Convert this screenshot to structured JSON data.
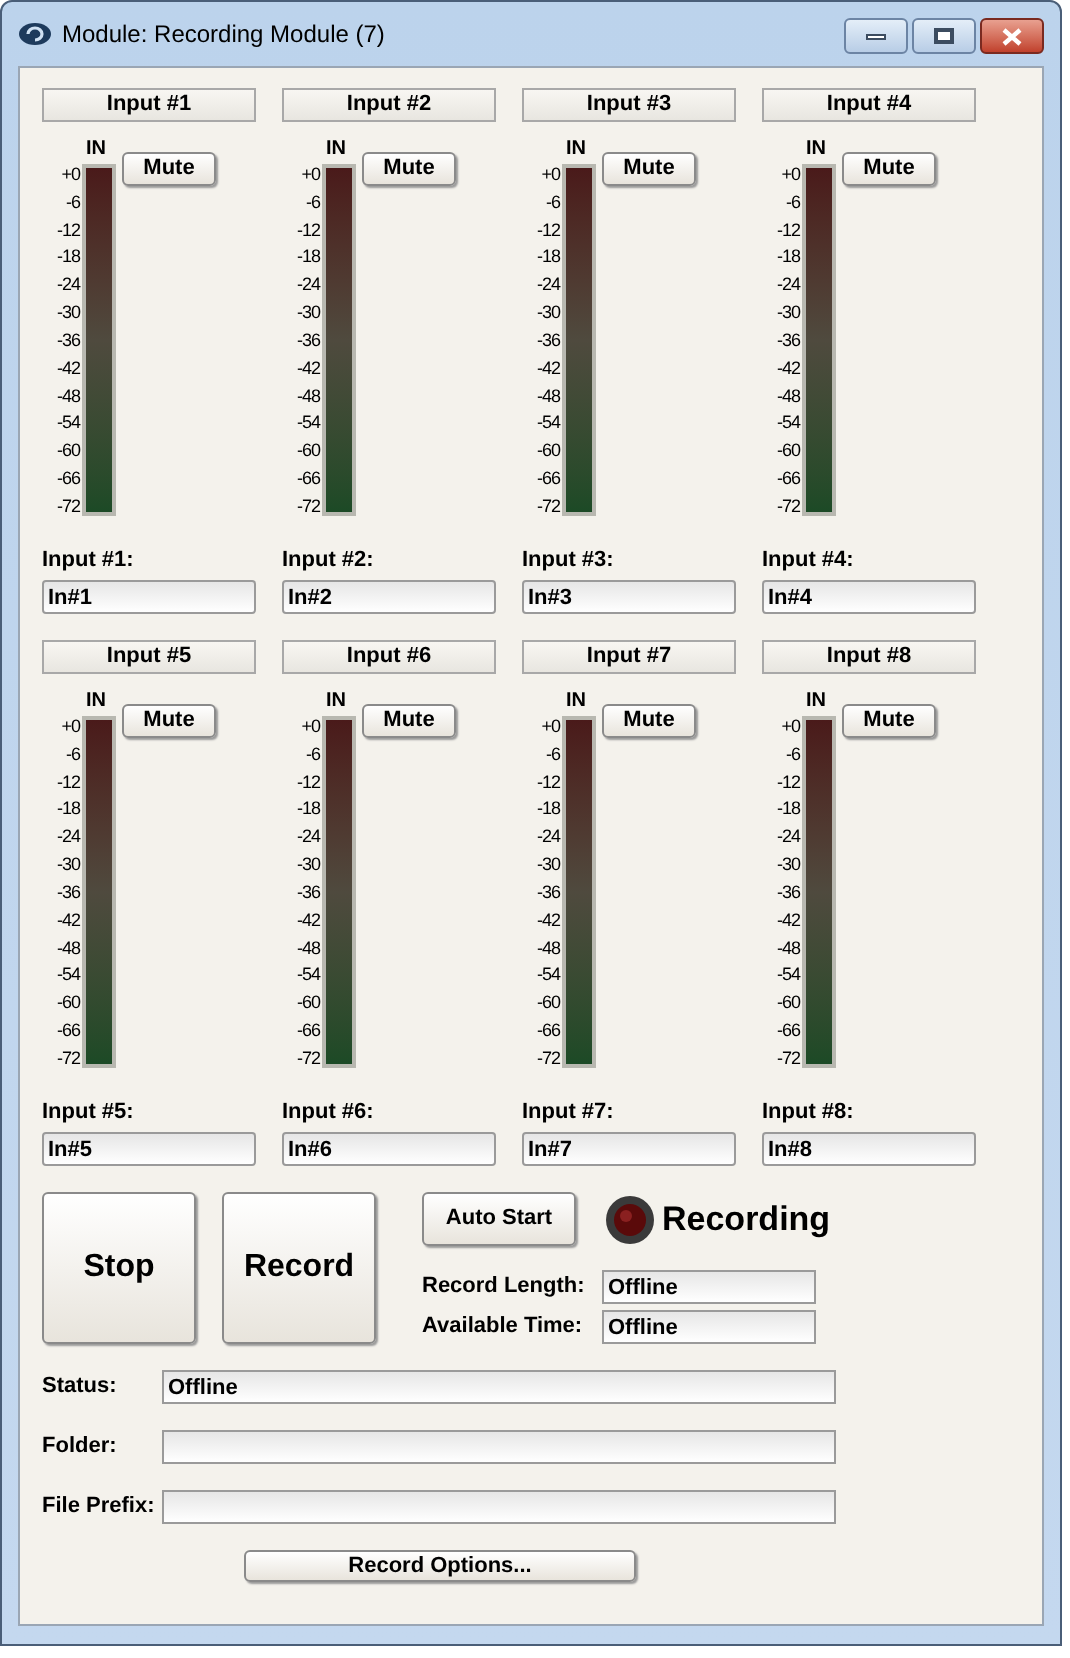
{
  "window": {
    "title": "Module: Recording Module (7)"
  },
  "channels": [
    {
      "header": "Input #1",
      "meter_label": "IN",
      "scale": [
        "+0",
        "-6",
        "-12",
        "-18",
        "-24",
        "-30",
        "-36",
        "-42",
        "-48",
        "-54",
        "-60",
        "-66",
        "-72"
      ],
      "mute": "Mute",
      "field_label": "Input #1:",
      "value": "In#1"
    },
    {
      "header": "Input #2",
      "meter_label": "IN",
      "scale": [
        "+0",
        "-6",
        "-12",
        "-18",
        "-24",
        "-30",
        "-36",
        "-42",
        "-48",
        "-54",
        "-60",
        "-66",
        "-72"
      ],
      "mute": "Mute",
      "field_label": "Input #2:",
      "value": "In#2"
    },
    {
      "header": "Input #3",
      "meter_label": "IN",
      "scale": [
        "+0",
        "-6",
        "-12",
        "-18",
        "-24",
        "-30",
        "-36",
        "-42",
        "-48",
        "-54",
        "-60",
        "-66",
        "-72"
      ],
      "mute": "Mute",
      "field_label": "Input #3:",
      "value": "In#3"
    },
    {
      "header": "Input #4",
      "meter_label": "IN",
      "scale": [
        "+0",
        "-6",
        "-12",
        "-18",
        "-24",
        "-30",
        "-36",
        "-42",
        "-48",
        "-54",
        "-60",
        "-66",
        "-72"
      ],
      "mute": "Mute",
      "field_label": "Input #4:",
      "value": "In#4"
    },
    {
      "header": "Input #5",
      "meter_label": "IN",
      "scale": [
        "+0",
        "-6",
        "-12",
        "-18",
        "-24",
        "-30",
        "-36",
        "-42",
        "-48",
        "-54",
        "-60",
        "-66",
        "-72"
      ],
      "mute": "Mute",
      "field_label": "Input #5:",
      "value": "In#5"
    },
    {
      "header": "Input #6",
      "meter_label": "IN",
      "scale": [
        "+0",
        "-6",
        "-12",
        "-18",
        "-24",
        "-30",
        "-36",
        "-42",
        "-48",
        "-54",
        "-60",
        "-66",
        "-72"
      ],
      "mute": "Mute",
      "field_label": "Input #6:",
      "value": "In#6"
    },
    {
      "header": "Input #7",
      "meter_label": "IN",
      "scale": [
        "+0",
        "-6",
        "-12",
        "-18",
        "-24",
        "-30",
        "-36",
        "-42",
        "-48",
        "-54",
        "-60",
        "-66",
        "-72"
      ],
      "mute": "Mute",
      "field_label": "Input #7:",
      "value": "In#7"
    },
    {
      "header": "Input #8",
      "meter_label": "IN",
      "scale": [
        "+0",
        "-6",
        "-12",
        "-18",
        "-24",
        "-30",
        "-36",
        "-42",
        "-48",
        "-54",
        "-60",
        "-66",
        "-72"
      ],
      "mute": "Mute",
      "field_label": "Input #8:",
      "value": "In#8"
    }
  ],
  "controls": {
    "stop": "Stop",
    "record": "Record",
    "auto_start": "Auto Start",
    "recording_label": "Recording",
    "recording_lit": false,
    "record_length": {
      "label": "Record Length:",
      "value": "Offline"
    },
    "available_time": {
      "label": "Available Time:",
      "value": "Offline"
    }
  },
  "fields": [
    {
      "label": "Status:",
      "value": "Offline"
    },
    {
      "label": "Folder:"
    },
    {
      "label": "File Prefix:"
    }
  ],
  "options_button": "Record Options..."
}
